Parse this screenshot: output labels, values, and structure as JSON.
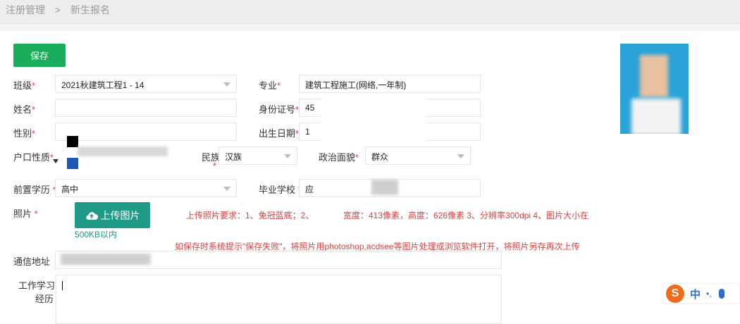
{
  "breadcrumb": {
    "parent": "注册管理",
    "separator": ">",
    "current": "新生报名"
  },
  "toolbar": {
    "save_label": "保存"
  },
  "form": {
    "class_label": "班级",
    "class_value": "2021秋建筑工程1 - 14",
    "major_label": "专业",
    "major_value": "建筑工程施工(网络,一年制)",
    "name_label": "姓名",
    "id_label": "身份证号",
    "id_value": "45",
    "gender_label": "性别",
    "birth_label": "出生日期",
    "birth_value": "1",
    "hukou_label": "户口性质",
    "ethnic_label": "民族",
    "ethnic_value": "汉族",
    "political_label": "政治面貌",
    "political_value": "群众",
    "edu_label": "前置学历",
    "edu_value": "高中",
    "school_label": "毕业学校",
    "school_value": "应",
    "photo_label": "照片",
    "upload_label": "上传图片",
    "photo_req": "上传照片要求：1、免冠蓝底；2、",
    "photo_req2": "宽度：413像素，高度：626像素 3、分辨率300dpi 4、图片大小在",
    "size_note": "500KB以内",
    "fail_note": "如保存时系统提示\"保存失败\"，将照片用photoshop,acdsee等图片处理或浏览软件打开，将照片另存再次上传",
    "address_label": "通信地址",
    "work_label_1": "工作学习",
    "work_label_2": "经历"
  },
  "required_mark": "*",
  "ime": {
    "logo": "S",
    "mode": "中",
    "punct": "•,"
  }
}
